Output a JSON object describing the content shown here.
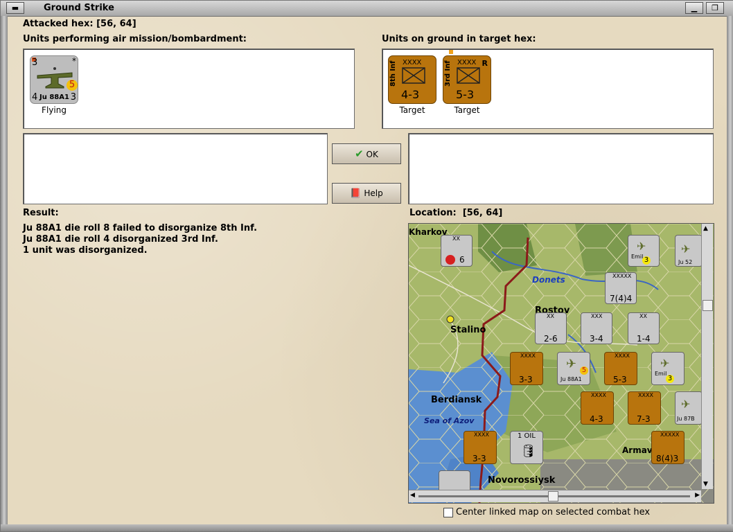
{
  "window": {
    "title": "Ground Strike"
  },
  "attacked_hex": {
    "label": "Attacked hex:",
    "value": "[56, 64]"
  },
  "air_units": {
    "label": "Units performing air mission/bombardment:",
    "items": [
      {
        "name": "Ju 88A1",
        "top_left": "3",
        "bottom_left": "4",
        "bottom_right": "3",
        "badge": "5",
        "corner": "*",
        "status": "Flying"
      }
    ]
  },
  "ground_units": {
    "label": "Units on ground in target hex:",
    "items": [
      {
        "side_label": "8th Inf",
        "size": "XXXX",
        "strength": "4-3",
        "flag": "",
        "status": "Target"
      },
      {
        "side_label": "3rd Inf",
        "size": "XXXX",
        "strength": "5-3",
        "flag": "R",
        "status": "Target"
      }
    ]
  },
  "buttons": {
    "ok": "OK",
    "help": "Help"
  },
  "result": {
    "label": "Result:",
    "lines": [
      "Ju 88A1 die roll 8 failed to disorganize 8th  Inf.",
      "Ju 88A1 die roll 4 disorganized 3rd Inf.",
      "1 unit was disorganized."
    ]
  },
  "location": {
    "label": "Location:",
    "value": "[56, 64]"
  },
  "map": {
    "place_names": [
      "Kharkov",
      "Donets",
      "Rostov",
      "Stalino",
      "Berdiansk",
      "Sea of Azov",
      "Novorossiysk",
      "Armav"
    ],
    "counters": [
      {
        "top": "XX",
        "value": "2-6"
      },
      {
        "top": "XXX",
        "value": "3-4"
      },
      {
        "top": "XX",
        "value": "1-4"
      },
      {
        "top": "XXXXX",
        "value": "7(4)4"
      },
      {
        "top": "XXXX",
        "value": "3-3"
      },
      {
        "top": "XXXX",
        "value": "5-3"
      },
      {
        "top": "XXXX",
        "value": "4-3"
      },
      {
        "top": "XXXX",
        "value": "7-3"
      },
      {
        "top": "XXXX",
        "value": "3-3"
      },
      {
        "top": "XXXXX",
        "value": "8(4)3"
      },
      {
        "top": "1 OIL",
        "value": ""
      },
      {
        "top": "XX",
        "value": "6"
      }
    ],
    "air_counters": [
      {
        "name": "Ju 88A1",
        "badge": "5"
      },
      {
        "name": "Ju 52",
        "badge": "3"
      },
      {
        "name": "Emil",
        "badge": "3"
      },
      {
        "name": "Ju 87B",
        "badge": ""
      }
    ]
  },
  "checkbox": {
    "label": "Center linked map on selected combat hex",
    "checked": false
  },
  "colors": {
    "axis_counter": "#b8740d",
    "air_counter": "#c8c8c8",
    "frontline": "#8b1a1a"
  }
}
